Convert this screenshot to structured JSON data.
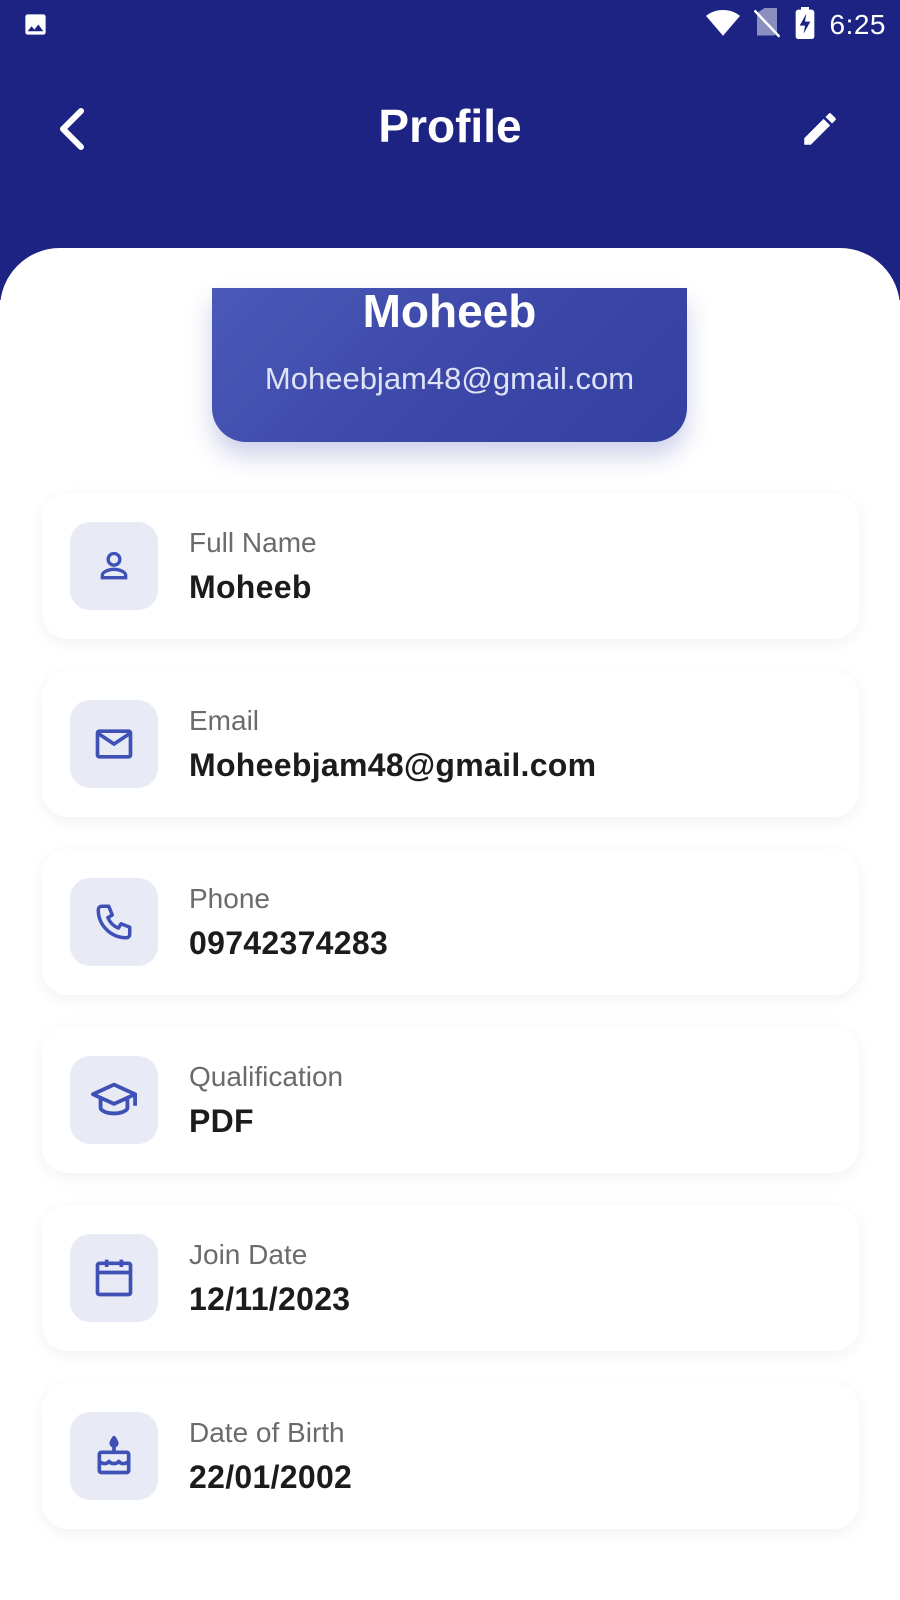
{
  "status_bar": {
    "time": "6:25"
  },
  "appbar": {
    "title": "Profile"
  },
  "hero": {
    "name": "Moheeb",
    "email": "Moheebjam48@gmail.com"
  },
  "fields": [
    {
      "label": "Full Name",
      "value": "Moheeb",
      "icon": "person-icon"
    },
    {
      "label": "Email",
      "value": "Moheebjam48@gmail.com",
      "icon": "mail-icon"
    },
    {
      "label": "Phone",
      "value": "09742374283",
      "icon": "phone-icon"
    },
    {
      "label": "Qualification",
      "value": "PDF",
      "icon": "graduation-cap-icon"
    },
    {
      "label": "Join Date",
      "value": "12/11/2023",
      "icon": "calendar-icon"
    },
    {
      "label": "Date of Birth",
      "value": "22/01/2002",
      "icon": "cake-icon"
    }
  ],
  "colors": {
    "header": "#1c2382",
    "accent": "#3f51b5",
    "icon_bg": "#e8eaf6"
  }
}
